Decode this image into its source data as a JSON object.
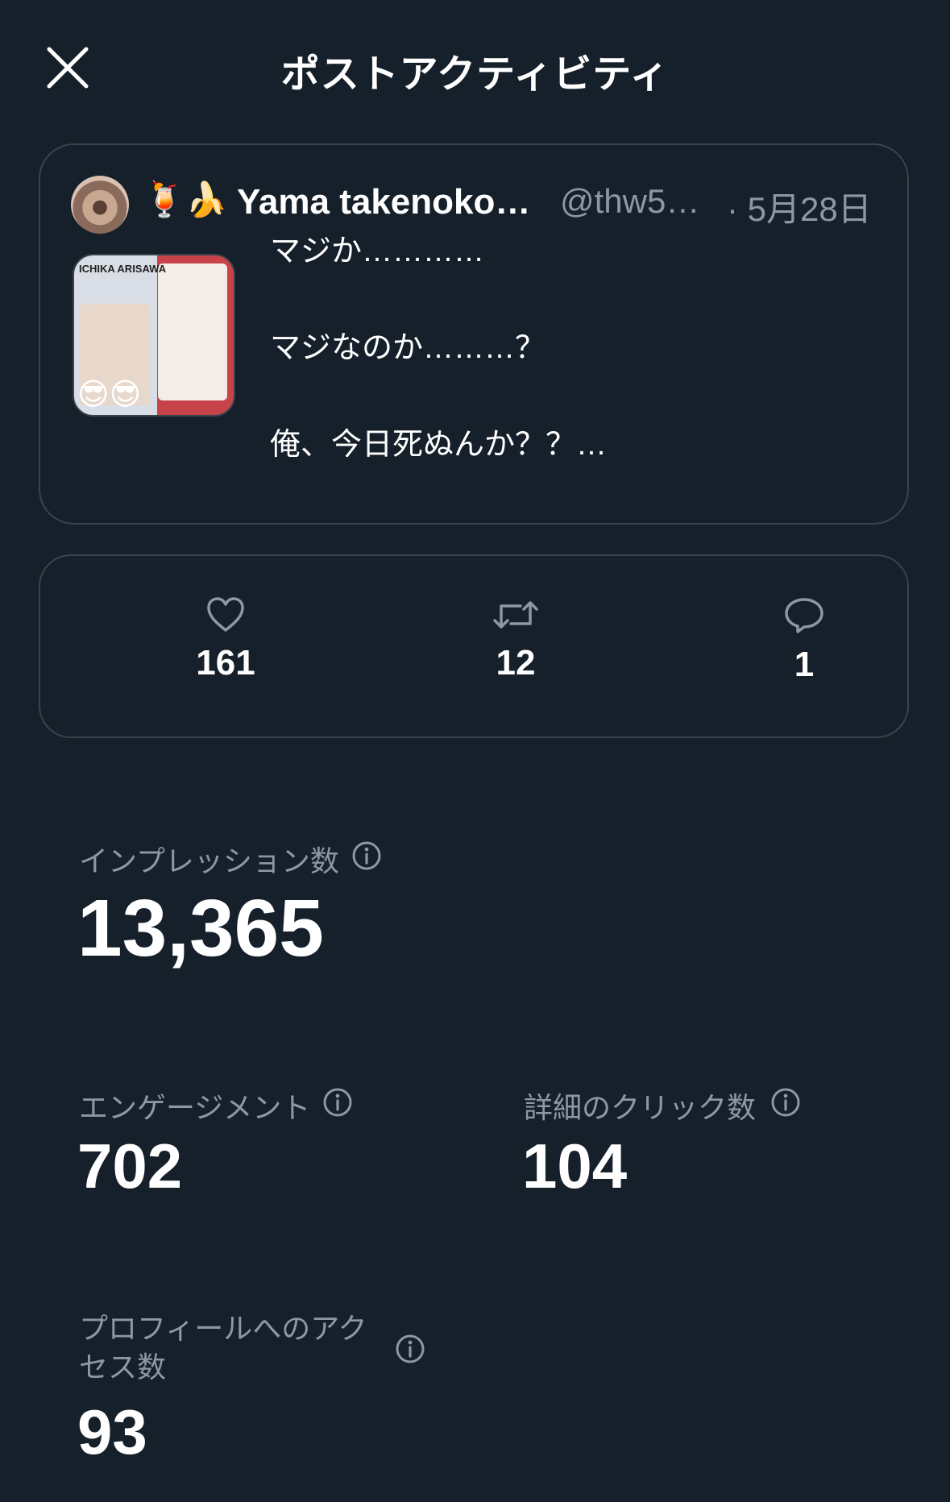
{
  "header": {
    "title": "ポストアクティビティ",
    "close_icon": "close-icon"
  },
  "post": {
    "emojis": "🍹🍌",
    "display_name": "Yama takenoko…",
    "handle": "@thw5…",
    "date": "· 5月28日",
    "thumbnail_text": "ICHIKA ARISAWA",
    "thumbnail_emoji": "😎😎",
    "lines": [
      "マジか…………",
      "マジなのか………？",
      "俺、今日死ぬんか？？…"
    ]
  },
  "counts": {
    "likes": "161",
    "reposts": "12",
    "replies": "1"
  },
  "metrics": {
    "impressions": {
      "label": "インプレッション数",
      "value": "13,365"
    },
    "engagements": {
      "label": "エンゲージメント",
      "value": "702"
    },
    "detail_clicks": {
      "label": "詳細のクリック数",
      "value": "104"
    },
    "profile_visits": {
      "label": "プロフィールへのアクセス数",
      "value": "93"
    }
  },
  "colors": {
    "background": "#15202b",
    "border": "#38444d",
    "secondary_text": "#8b98a5",
    "primary_text": "#ffffff"
  }
}
